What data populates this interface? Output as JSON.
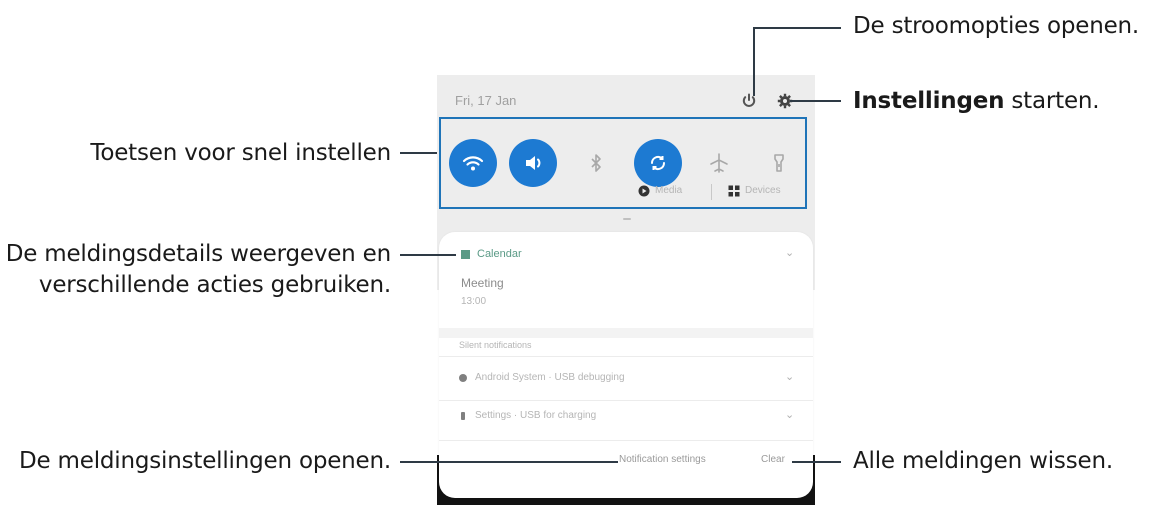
{
  "callouts": {
    "power_options": "De stroomopties openen.",
    "settings_bold": "Instellingen",
    "settings_rest": " starten.",
    "quick_settings": "Toetsen voor snel instellen",
    "notification_details_line1": "De meldingsdetails weergeven en",
    "notification_details_line2": "verschillende acties gebruiken.",
    "notification_settings": "De meldingsinstellingen openen.",
    "clear_all": "Alle meldingen wissen."
  },
  "panel": {
    "status_time": "Fri, 17 Jan",
    "quick_settings_tiles": [
      {
        "name": "wifi-icon",
        "state": "on"
      },
      {
        "name": "sound-icon",
        "state": "on"
      },
      {
        "name": "bluetooth-icon",
        "state": "off"
      },
      {
        "name": "auto-rotate-icon",
        "state": "on"
      },
      {
        "name": "airplane-mode-icon",
        "state": "off"
      },
      {
        "name": "flashlight-icon",
        "state": "off"
      }
    ],
    "media_label": "Media",
    "devices_label": "Devices",
    "notification": {
      "app_name": "Calendar",
      "title": "Meeting",
      "time": "13:00"
    },
    "silent_header": "Silent notifications",
    "silent_items": [
      "Android System · USB debugging",
      "Settings · USB for charging"
    ],
    "footer": {
      "notification_settings": "Notification settings",
      "clear": "Clear"
    }
  },
  "colors": {
    "accent_blue": "#1d7ad2",
    "callout_box": "#1f74b8",
    "leader_line": "#2e3a45"
  }
}
